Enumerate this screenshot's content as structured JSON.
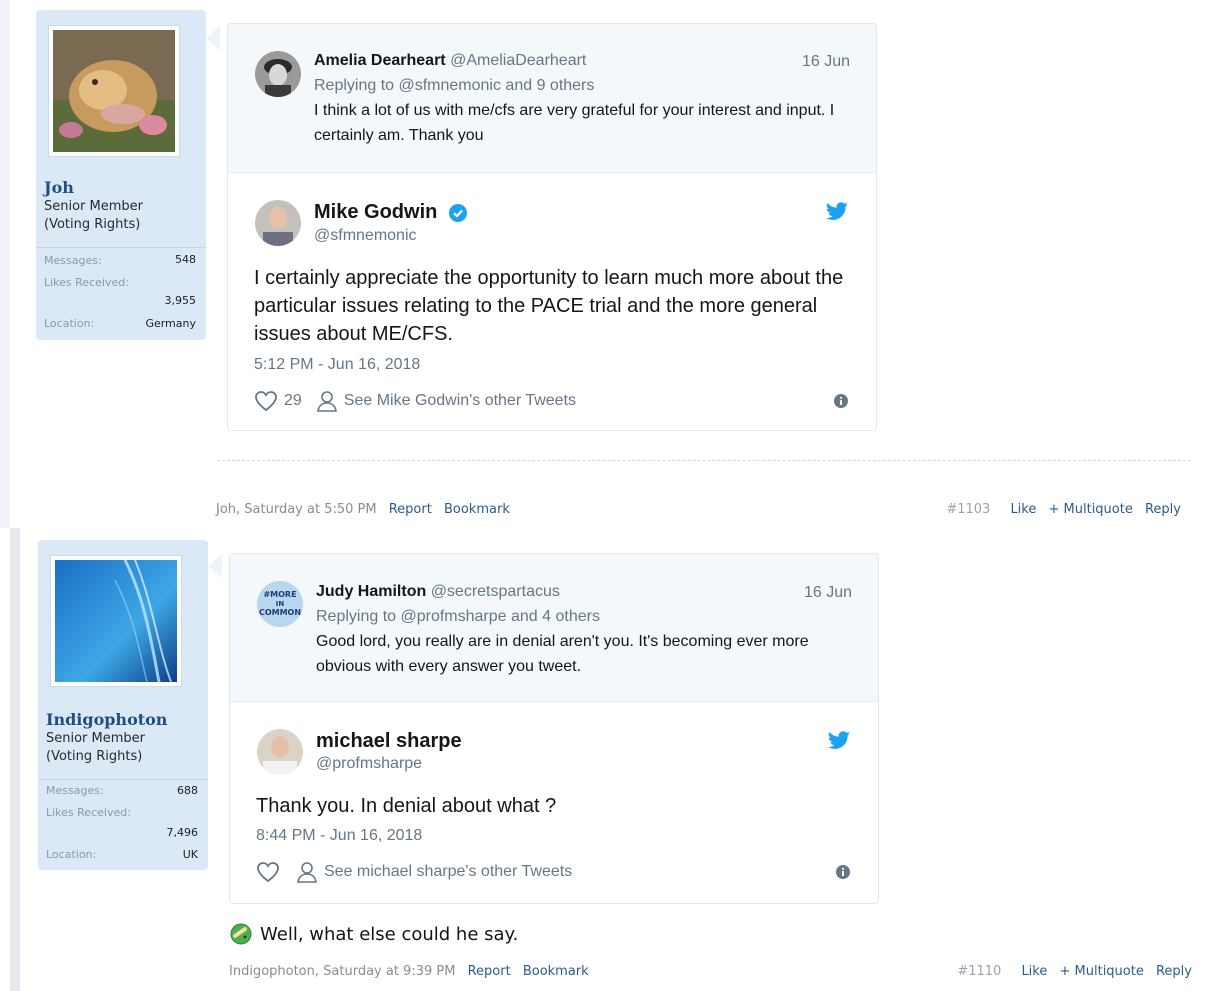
{
  "posts": [
    {
      "user": {
        "name": "Joh",
        "title": "Senior Member\n(Voting Rights)",
        "stats": {
          "messages_label": "Messages:",
          "messages": "548",
          "likes_label": "Likes Received:",
          "likes": "3,955",
          "location_label": "Location:",
          "location": "Germany"
        }
      },
      "tweet": {
        "quoted": {
          "name": "Amelia Dearheart",
          "handle": "@AmeliaDearheart",
          "date": "16 Jun",
          "replying": "Replying to @sfmnemonic and 9 others",
          "text": "I think a lot of us with me/cfs are very grateful for your interest and input. I certainly am. Thank you"
        },
        "main": {
          "name": "Mike Godwin",
          "handle": "@sfmnemonic",
          "text": "I certainly appreciate the opportunity to learn much more about the particular issues relating to the PACE trial and the more general issues about ME/CFS.",
          "time": "5:12 PM - Jun 16, 2018",
          "likes": "29",
          "see_other": "See Mike Godwin's other Tweets"
        }
      },
      "footer": {
        "author_time": "Joh, Saturday at 5:50 PM",
        "report": "Report",
        "bookmark": "Bookmark",
        "post_number": "#1103",
        "like": "Like",
        "multiquote": "+ Multiquote",
        "reply": "Reply"
      }
    },
    {
      "user": {
        "name": "Indigophoton",
        "title": "Senior Member\n(Voting Rights)",
        "stats": {
          "messages_label": "Messages:",
          "messages": "688",
          "likes_label": "Likes Received:",
          "likes": "7,496",
          "location_label": "Location:",
          "location": "UK"
        }
      },
      "tweet": {
        "quoted": {
          "avatar_text": "#MORE IN COMMON",
          "name": "Judy Hamilton",
          "handle": "@secretspartacus",
          "date": "16 Jun",
          "replying": "Replying to @profmsharpe and 4 others",
          "text": "Good lord, you really are in denial aren't you. It's becoming ever more obvious with every answer you tweet."
        },
        "main": {
          "name": "michael sharpe",
          "handle": "@profmsharpe",
          "text": "Thank you. In denial about what ?",
          "time": "8:44 PM - Jun 16, 2018",
          "see_other": "See michael sharpe's other Tweets"
        }
      },
      "message": "Well, what else could he say.",
      "footer": {
        "author_time": "Indigophoton, Saturday at 9:39 PM",
        "report": "Report",
        "bookmark": "Bookmark",
        "post_number": "#1110",
        "like": "Like",
        "multiquote": "+ Multiquote",
        "reply": "Reply"
      }
    }
  ],
  "colors": {
    "twitter_blue": "#1da1f2",
    "username": "#1e4f80",
    "link": "#2b5c8a",
    "userblock_bg": "#dbe8f5"
  }
}
